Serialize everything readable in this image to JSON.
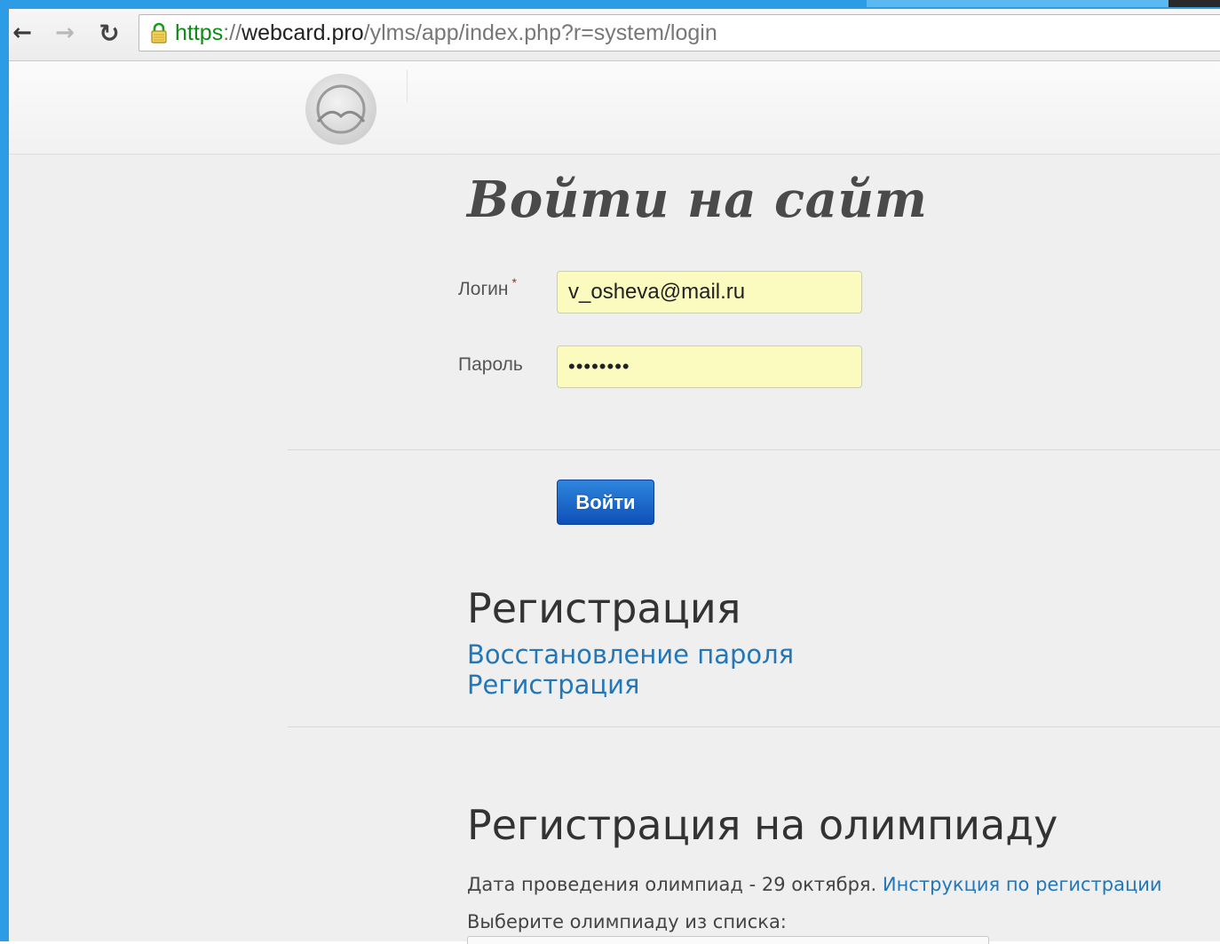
{
  "browser": {
    "back_icon": "arrow-left-icon",
    "forward_icon": "arrow-right-icon",
    "reload_icon": "reload-icon",
    "url_scheme": "https",
    "url_sep": "://",
    "url_host": "webcard.pro",
    "url_path": "/ylms/app/index.php?r=system/login",
    "colors": {
      "secure": "#0f8a17",
      "frame": "#2e9be6"
    }
  },
  "login": {
    "title": "Войти на сайт",
    "login_label": "Логин",
    "required_mark": "*",
    "login_value": "v_osheva@mail.ru",
    "password_label": "Пароль",
    "password_value": "••••••••",
    "submit_label": "Войти"
  },
  "registration": {
    "title": "Регистрация",
    "recover_link": "Восстановление пароля",
    "register_link": "Регистрация"
  },
  "olympiad": {
    "title": "Регистрация на олимпиаду",
    "date_text": "Дата проведения олимпиад - 29 октября.",
    "instructions_link": "Инструкция по регистрации",
    "choose_text": "Выберите олимпиаду из списка:"
  },
  "colors": {
    "link": "#2377b8",
    "button": "#0e50b8",
    "autofill": "#fbfbbf"
  }
}
